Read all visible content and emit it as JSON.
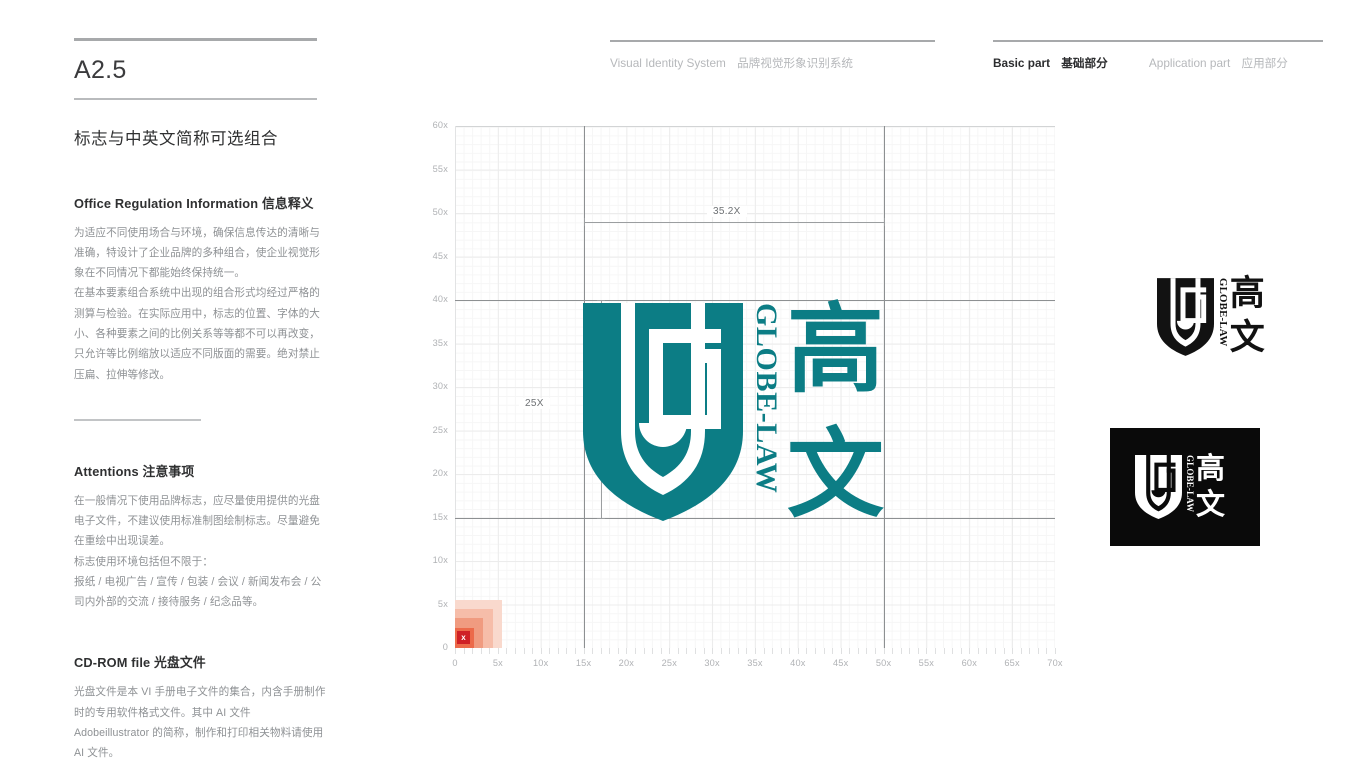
{
  "page": {
    "code": "A2.5",
    "section_title": "标志与中英文简称可选组合"
  },
  "header": {
    "left": {
      "en": "Visual Identity System",
      "cn": "品牌视觉形象识别系统"
    },
    "right": {
      "basic_en": "Basic part",
      "basic_cn": "基础部分",
      "application_en": "Application part",
      "application_cn": "应用部分"
    }
  },
  "sections": [
    {
      "title_en": "Office Regulation Information",
      "title_cn": "信息释义",
      "paragraphs": [
        "为适应不同使用场合与环境，确保信息传达的清晰与准确，特设计了企业品牌的多种组合，使企业视觉形象在不同情况下都能始终保持统一。",
        "在基本要素组合系统中出现的组合形式均经过严格的测算与检验。在实际应用中，标志的位置、字体的大小、各种要素之间的比例关系等等都不可以再改变，只允许等比例缩放以适应不同版面的需要。绝对禁止压扁、拉伸等修改。"
      ]
    },
    {
      "title_en": "Attentions",
      "title_cn": "注意事项",
      "paragraphs": [
        "在一般情况下使用品牌标志，应尽量使用提供的光盘电子文件，不建议使用标准制图绘制标志。尽量避免在重绘中出现误差。",
        "标志使用环境包括但不限于：",
        "报纸 / 电视广告 / 宣传 / 包装 / 会议 / 新闻发布会 / 公司内外部的交流 / 接待服务 / 纪念品等。"
      ]
    },
    {
      "title_en": "CD-ROM file",
      "title_cn": "光盘文件",
      "paragraphs": [
        "光盘文件是本 VI 手册电子文件的集合，内含手册制作时的专用软件格式文件。其中 AI 文件 Adobeillustrator 的简称，制作和打印相关物料请使用 AI 文件。"
      ]
    }
  ],
  "chart_data": {
    "type": "table",
    "title": "",
    "xlabel": "",
    "ylabel": "",
    "grid": true,
    "xlim": [
      0,
      70
    ],
    "ylim": [
      0,
      60
    ],
    "x_ticks": [
      "0",
      "5x",
      "10x",
      "15x",
      "20x",
      "25x",
      "30x",
      "35x",
      "40x",
      "45x",
      "50x",
      "55x",
      "60x",
      "65x",
      "70x"
    ],
    "y_ticks": [
      "0",
      "5x",
      "10x",
      "15x",
      "20x",
      "25x",
      "30x",
      "35x",
      "40x",
      "45x",
      "50x",
      "55x",
      "60x"
    ],
    "annotations": [
      {
        "label": "35.2X",
        "orientation": "horizontal",
        "from": 15,
        "to": 50,
        "at": 49
      },
      {
        "label": "25X",
        "orientation": "vertical",
        "from": 15,
        "to": 40,
        "at": 17
      }
    ],
    "reference_lines": [
      {
        "orientation": "horizontal",
        "value": 40
      },
      {
        "orientation": "horizontal",
        "value": 15
      },
      {
        "orientation": "vertical",
        "value": 15
      },
      {
        "orientation": "vertical",
        "value": 50
      }
    ],
    "unit_swatch": {
      "badge": "x",
      "steps": [
        5,
        4,
        3,
        2
      ]
    }
  },
  "logo": {
    "latin_name": "GLOBE-LAW",
    "cn_char_1": "高",
    "cn_char_2": "文",
    "teal": "#0c7d85",
    "black": "#121212",
    "white": "#ffffff"
  }
}
